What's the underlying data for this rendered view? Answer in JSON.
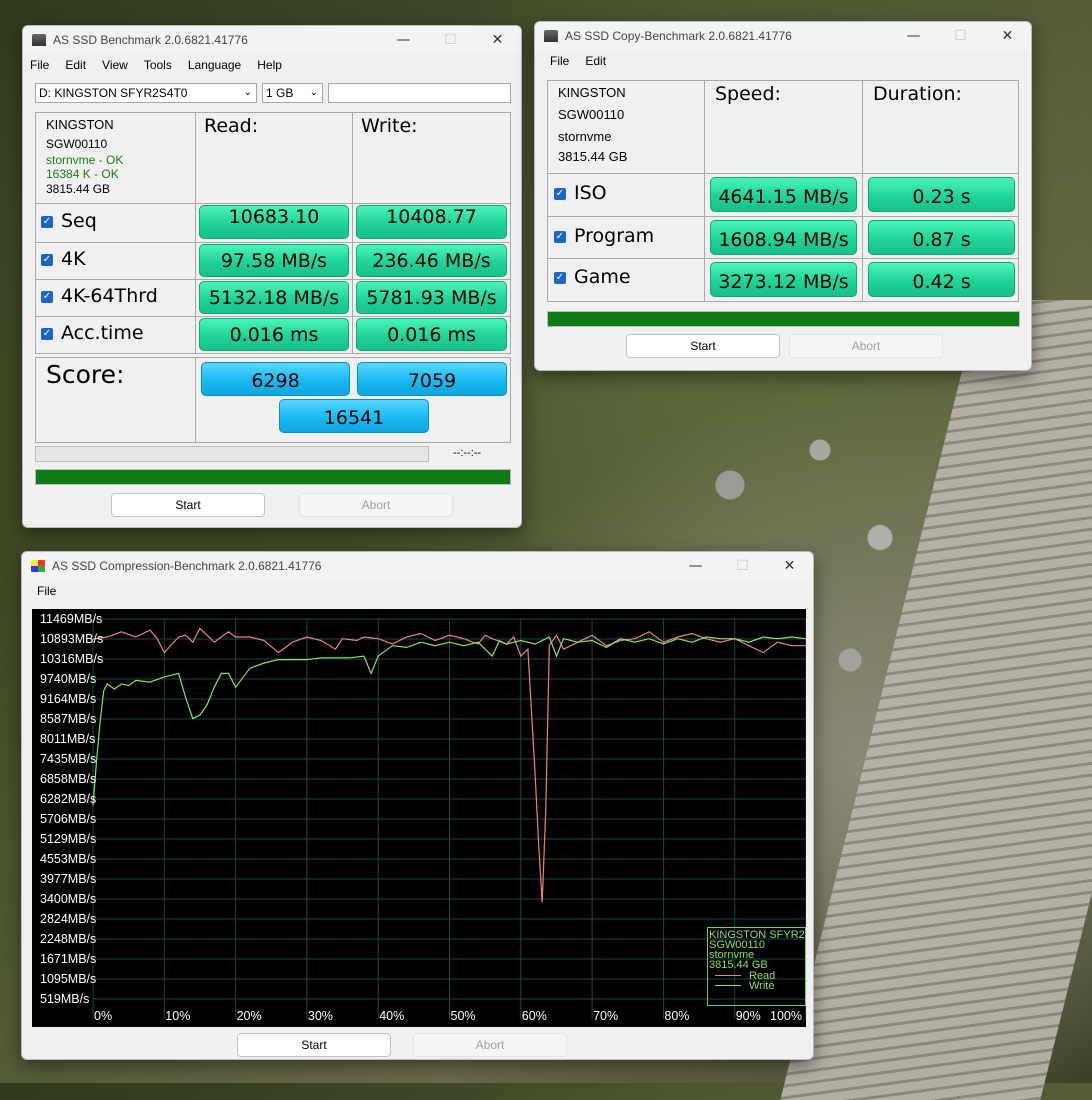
{
  "main": {
    "title": "AS SSD Benchmark 2.0.6821.41776",
    "menu": [
      "File",
      "Edit",
      "View",
      "Tools",
      "Language",
      "Help"
    ],
    "drive_select": "D: KINGSTON SFYR2S4T0",
    "size_select": "1 GB",
    "path_input": "",
    "info": [
      "KINGSTON",
      "SGW00110",
      "stornvme - OK",
      "16384 K - OK",
      "3815.44 GB"
    ],
    "header_read": "Read:",
    "header_write": "Write:",
    "rows": [
      {
        "label": "Seq",
        "read": "10683.10",
        "write": "10408.77"
      },
      {
        "label": "4K",
        "read": "97.58 MB/s",
        "write": "236.46 MB/s"
      },
      {
        "label": "4K-64Thrd",
        "read": "5132.18 MB/s",
        "write": "5781.93 MB/s"
      },
      {
        "label": "Acc.time",
        "read": "0.016 ms",
        "write": "0.016 ms"
      }
    ],
    "score_label": "Score:",
    "score_read": "6298",
    "score_write": "7059",
    "score_total": "16541",
    "timer": "--:--:--",
    "progress": 1.0,
    "start": "Start",
    "abort": "Abort"
  },
  "copy": {
    "title": "AS SSD Copy-Benchmark 2.0.6821.41776",
    "menu": [
      "File",
      "Edit"
    ],
    "info": [
      "KINGSTON",
      "SGW00110",
      "stornvme",
      "3815.44 GB"
    ],
    "header_speed": "Speed:",
    "header_duration": "Duration:",
    "rows": [
      {
        "label": "ISO",
        "speed": "4641.15 MB/s",
        "duration": "0.23 s"
      },
      {
        "label": "Program",
        "speed": "1608.94 MB/s",
        "duration": "0.87 s"
      },
      {
        "label": "Game",
        "speed": "3273.12 MB/s",
        "duration": "0.42 s"
      }
    ],
    "progress": 1.0,
    "start": "Start",
    "abort": "Abort"
  },
  "compression": {
    "title": "AS SSD Compression-Benchmark 2.0.6821.41776",
    "menu": [
      "File"
    ],
    "legend": [
      "KINGSTON SFYR2S",
      "SGW00110",
      "stornvme",
      "3815.44 GB"
    ],
    "start": "Start",
    "abort": "Abort"
  },
  "chart_data": {
    "type": "line",
    "y_tick_labels": [
      "11469MB/s",
      "10893MB/s",
      "10316MB/s",
      "9740MB/s",
      "9164MB/s",
      "8587MB/s",
      "8011MB/s",
      "7435MB/s",
      "6858MB/s",
      "6282MB/s",
      "5706MB/s",
      "5129MB/s",
      "4553MB/s",
      "3977MB/s",
      "3400MB/s",
      "2824MB/s",
      "2248MB/s",
      "1671MB/s",
      "1095MB/s",
      "519MB/s"
    ],
    "x_tick_labels": [
      "0%",
      "10%",
      "20%",
      "30%",
      "40%",
      "50%",
      "60%",
      "70%",
      "80%",
      "90%",
      "100%"
    ],
    "xlim": [
      0,
      100
    ],
    "ylim": [
      519,
      11469
    ],
    "grid": true,
    "legend_position": "bottom-right",
    "colors": {
      "read": "#f08080",
      "write": "#8fe05a",
      "background": "#000000",
      "grid": "#1a4a4a"
    },
    "series": [
      {
        "name": "Read",
        "x": [
          0,
          2,
          4,
          6,
          8,
          9,
          10,
          12,
          13,
          14,
          15,
          17,
          19,
          20,
          22,
          24,
          26,
          28,
          30,
          32,
          34,
          35,
          37,
          38,
          40,
          42,
          44,
          46,
          48,
          50,
          52,
          54,
          55,
          56,
          58,
          59,
          60,
          61,
          62,
          62.5,
          63,
          63.5,
          64,
          65,
          66,
          68,
          70,
          72,
          74,
          76,
          78,
          80,
          82,
          84,
          86,
          88,
          90,
          92,
          94,
          96,
          98,
          100
        ],
        "y": [
          10893,
          10950,
          11100,
          10950,
          11150,
          10900,
          10500,
          10950,
          11000,
          10800,
          11200,
          10800,
          11100,
          10950,
          10950,
          10850,
          10500,
          10800,
          10950,
          10850,
          10600,
          10900,
          10850,
          10950,
          10900,
          10750,
          10950,
          11050,
          10850,
          11000,
          10900,
          10750,
          11000,
          10900,
          10750,
          10950,
          10400,
          10600,
          7000,
          5000,
          3300,
          6000,
          10700,
          11000,
          10600,
          10800,
          11000,
          10700,
          10850,
          10900,
          11100,
          10800,
          10950,
          11050,
          10900,
          10800,
          10900,
          10700,
          10500,
          10800,
          10700,
          10700
        ]
      },
      {
        "name": "Write",
        "x": [
          0,
          0.5,
          1,
          1.5,
          2,
          3,
          4,
          5,
          6,
          8,
          10,
          12,
          13,
          14,
          15,
          16,
          17,
          18,
          19,
          20,
          22,
          24,
          26,
          28,
          30,
          32,
          34,
          36,
          38,
          39,
          40,
          42,
          44,
          46,
          48,
          50,
          52,
          54,
          56,
          57,
          58,
          60,
          62,
          64,
          65,
          66,
          68,
          70,
          72,
          74,
          76,
          78,
          80,
          82,
          84,
          86,
          88,
          90,
          92,
          94,
          96,
          98,
          100
        ],
        "y": [
          6100,
          7400,
          8500,
          9400,
          9600,
          9450,
          9600,
          9550,
          9700,
          9650,
          9800,
          9900,
          9200,
          8600,
          8700,
          9000,
          9500,
          9900,
          9900,
          9500,
          10050,
          10200,
          10300,
          10300,
          10300,
          10350,
          10350,
          10350,
          10400,
          9900,
          10400,
          10700,
          10650,
          10800,
          10700,
          10800,
          10700,
          10800,
          10400,
          10850,
          10750,
          10850,
          10750,
          10950,
          10400,
          10900,
          10800,
          10850,
          10650,
          10900,
          10800,
          10900,
          10750,
          10900,
          10800,
          10950,
          10900,
          10900,
          10800,
          10950,
          10900,
          10950,
          10900
        ]
      }
    ]
  }
}
